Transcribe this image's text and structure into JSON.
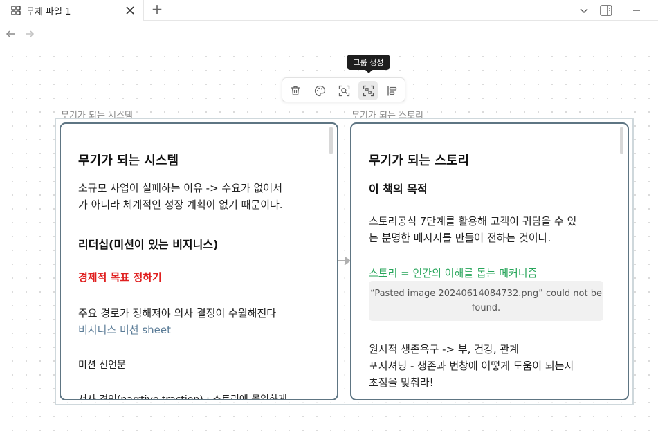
{
  "tab": {
    "title": "무제 파일 1",
    "icon": "canvas-icon",
    "close_icon": "close-icon"
  },
  "new_tab_label": "+",
  "window_controls": [
    "chevron-down-icon",
    "sidebar-toggle-icon",
    "minimize-icon"
  ],
  "nav": {
    "back": "←",
    "forward": "→"
  },
  "tooltip": "그룹 생성",
  "toolbar": {
    "tools": [
      {
        "name": "delete",
        "icon": "trash-icon"
      },
      {
        "name": "color",
        "icon": "palette-icon"
      },
      {
        "name": "zoom-to-selection",
        "icon": "zoom-selection-icon"
      },
      {
        "name": "create-group",
        "icon": "group-icon",
        "active": true
      },
      {
        "name": "align",
        "icon": "align-icon"
      }
    ]
  },
  "group_labels": {
    "left": "무기가 되는 시스템",
    "right": "무기가 되는 스토리"
  },
  "cards": {
    "left": {
      "title": "무기가 되는 시스템",
      "p1_line1": "소규모 사업이 실패하는 이유 -> 수요가 없어서",
      "p1_line2": "가 아니라 체계적인 성장 계획이 없기 때문이다.",
      "heading2": "리더십(미션이 있는 비지니스)",
      "red_heading": "경제적 목표 정하기",
      "p2": "주요 경로가 정해져야 의사 결정이 수월해진다",
      "link": "비지니스 미션 sheet",
      "p3": "미션 선언문",
      "p4": "서사 견인(narrtive traction) : 스토리에 몰입하게"
    },
    "right": {
      "title": "무기가 되는 스토리",
      "heading2": "이 책의 목적",
      "p1_line1": "스토리공식 7단계를 활용해 고객이 귀담을 수 있",
      "p1_line2": "는 분명한 메시지를 만들어 전하는 것이다.",
      "green_heading": "스토리 = 인간의 이해를 돕는 메커니즘",
      "missing_image": "“Pasted image 20240614084732.png” could not be found.",
      "p2_line1": "원시적 생존욕구 -> 부, 건강, 관계",
      "p2_line2": "포지셔닝 - 생존과 번창에 어떻게 도움이 되는지",
      "p2_line3": "초점을 맞춰라!"
    }
  },
  "colors": {
    "card_border": "#5e7583",
    "group_border": "#cfd8dc",
    "red_text": "#e02020",
    "green_text": "#27a55a",
    "link_text": "#5b7c97"
  }
}
